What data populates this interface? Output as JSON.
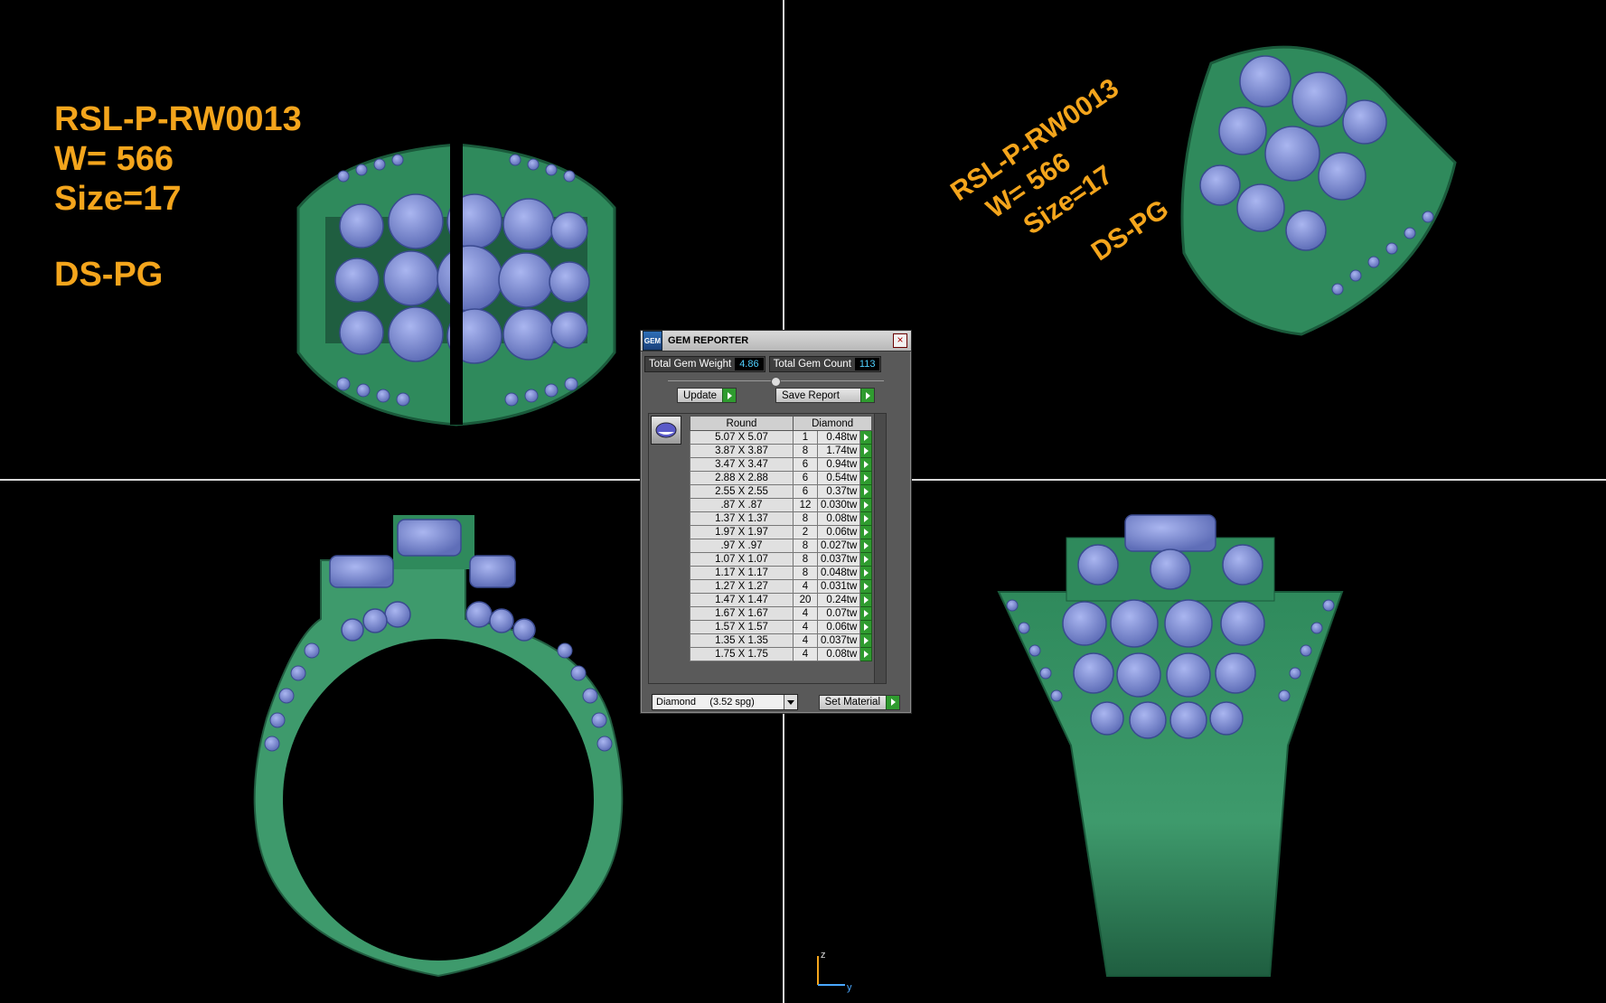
{
  "label_top_left": {
    "line1": "RSL-P-RW0013",
    "line2": "W= 566",
    "line3": "Size=17",
    "line4": "DS-PG"
  },
  "label_top_right": {
    "line1": "RSL-P-RW0013",
    "line2": "W= 566",
    "line3": "Size=17",
    "line4": "DS-PG"
  },
  "dialog": {
    "title": "GEM REPORTER",
    "logo_text": "GEM",
    "total_gem_weight_label": "Total Gem Weight",
    "total_gem_weight": "4.86",
    "total_gem_count_label": "Total Gem Count",
    "total_gem_count": "113",
    "update_label": "Update",
    "save_report_label": "Save Report",
    "table_headers": {
      "shape": "Round",
      "material": "Diamond"
    },
    "rows": [
      {
        "size": "5.07 X 5.07",
        "count": "1",
        "weight": "0.48tw"
      },
      {
        "size": "3.87 X 3.87",
        "count": "8",
        "weight": "1.74tw"
      },
      {
        "size": "3.47 X 3.47",
        "count": "6",
        "weight": "0.94tw"
      },
      {
        "size": "2.88 X 2.88",
        "count": "6",
        "weight": "0.54tw"
      },
      {
        "size": "2.55 X 2.55",
        "count": "6",
        "weight": "0.37tw"
      },
      {
        "size": ".87 X .87",
        "count": "12",
        "weight": "0.030tw"
      },
      {
        "size": "1.37 X 1.37",
        "count": "8",
        "weight": "0.08tw"
      },
      {
        "size": "1.97 X 1.97",
        "count": "2",
        "weight": "0.06tw"
      },
      {
        "size": ".97 X .97",
        "count": "8",
        "weight": "0.027tw"
      },
      {
        "size": "1.07 X 1.07",
        "count": "8",
        "weight": "0.037tw"
      },
      {
        "size": "1.17 X 1.17",
        "count": "8",
        "weight": "0.048tw"
      },
      {
        "size": "1.27 X 1.27",
        "count": "4",
        "weight": "0.031tw"
      },
      {
        "size": "1.47 X 1.47",
        "count": "20",
        "weight": "0.24tw"
      },
      {
        "size": "1.67 X 1.67",
        "count": "4",
        "weight": "0.07tw"
      },
      {
        "size": "1.57 X 1.57",
        "count": "4",
        "weight": "0.06tw"
      },
      {
        "size": "1.35 X 1.35",
        "count": "4",
        "weight": "0.037tw"
      },
      {
        "size": "1.75 X 1.75",
        "count": "4",
        "weight": "0.08tw"
      }
    ],
    "material_select": "Diamond     (3.52 spg)",
    "set_material_label": "Set Material"
  },
  "axes": {
    "z": "z",
    "y": "y"
  },
  "colors": {
    "metal": "#3e9a6c",
    "metal_dark": "#1f5e40",
    "gem": "#7f8fd8",
    "label": "#f4a51c"
  }
}
